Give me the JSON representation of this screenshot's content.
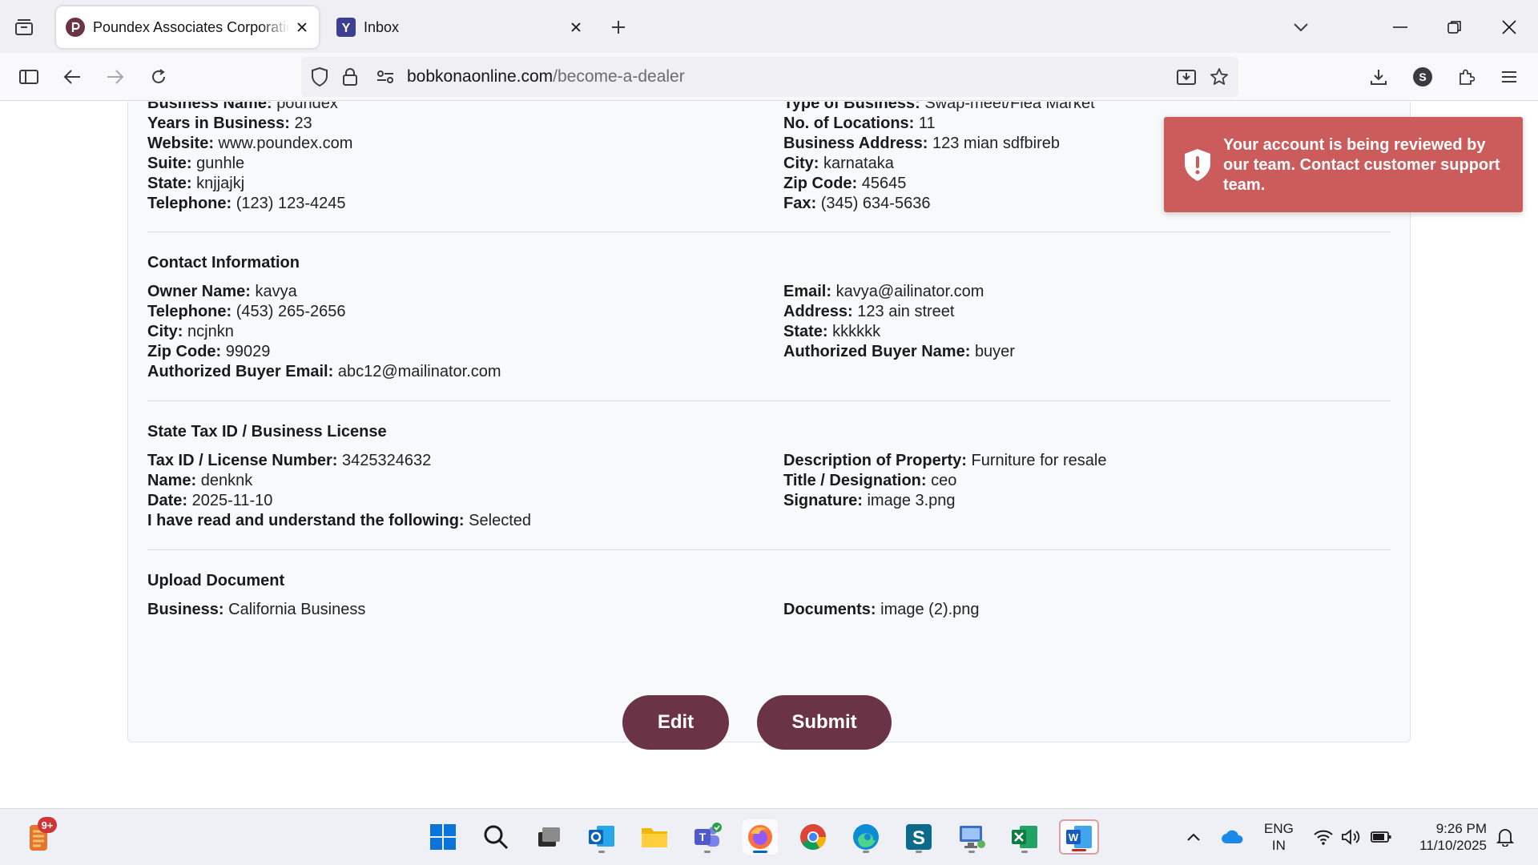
{
  "browser": {
    "tabs": [
      {
        "title": "Poundex Associates Corporation",
        "active": true
      },
      {
        "title": "Inbox",
        "active": false
      }
    ],
    "url": {
      "domain": "bobkonaonline.com",
      "path": "/become-a-dealer"
    },
    "profile_initial": "S"
  },
  "business": {
    "left": [
      {
        "label": "Business Name:",
        "value": "poundex"
      },
      {
        "label": "Years in Business:",
        "value": "23"
      },
      {
        "label": "Website:",
        "value": "www.poundex.com"
      },
      {
        "label": "Suite:",
        "value": "gunhle"
      },
      {
        "label": "State:",
        "value": "knjjajkj"
      },
      {
        "label": "Telephone:",
        "value": "(123) 123-4245"
      }
    ],
    "right": [
      {
        "label": "Type of Business:",
        "value": "Swap-meet/Flea Market"
      },
      {
        "label": "No. of Locations:",
        "value": "11"
      },
      {
        "label": "Business Address:",
        "value": "123 mian sdfbireb"
      },
      {
        "label": "City:",
        "value": "karnataka"
      },
      {
        "label": "Zip Code:",
        "value": "45645"
      },
      {
        "label": "Fax:",
        "value": "(345) 634-5636"
      }
    ]
  },
  "contact": {
    "title": "Contact Information",
    "left": [
      {
        "label": "Owner Name:",
        "value": "kavya"
      },
      {
        "label": "Telephone:",
        "value": "(453) 265-2656"
      },
      {
        "label": "City:",
        "value": "ncjnkn"
      },
      {
        "label": "Zip Code:",
        "value": "99029"
      },
      {
        "label": "Authorized Buyer Email:",
        "value": "abc12@mailinator.com"
      }
    ],
    "right": [
      {
        "label": "Email:",
        "value": "kavya@ailinator.com"
      },
      {
        "label": "Address:",
        "value": "123 ain street"
      },
      {
        "label": "State:",
        "value": "kkkkkk"
      },
      {
        "label": "Authorized Buyer Name:",
        "value": "buyer"
      }
    ]
  },
  "tax": {
    "title": "State Tax ID / Business License",
    "left": [
      {
        "label": "Tax ID / License Number:",
        "value": "3425324632"
      },
      {
        "label": "Name:",
        "value": "denknk"
      },
      {
        "label": "Date:",
        "value": "2025-11-10"
      },
      {
        "label": "I have read and understand the following:",
        "value": "Selected"
      }
    ],
    "right": [
      {
        "label": "Description of Property:",
        "value": "Furniture for resale"
      },
      {
        "label": "Title / Designation:",
        "value": "ceo"
      },
      {
        "label": "Signature:",
        "value": "image 3.png"
      }
    ]
  },
  "upload": {
    "title": "Upload Document",
    "left": [
      {
        "label": "Business:",
        "value": "California Business"
      }
    ],
    "right": [
      {
        "label": "Documents:",
        "value": "image (2).png"
      }
    ]
  },
  "actions": {
    "edit": "Edit",
    "submit": "Submit"
  },
  "toast": {
    "message": "Your account is being reviewed by our team. Contact customer support team."
  },
  "taskbar": {
    "notification_badge": "9+",
    "language": {
      "line1": "ENG",
      "line2": "IN"
    },
    "time": "9:26 PM",
    "date": "11/10/2025"
  },
  "colors": {
    "primary_button": "#6b3346",
    "toast_bg": "#cc5b5b",
    "card_bg": "#f8f9fb"
  }
}
